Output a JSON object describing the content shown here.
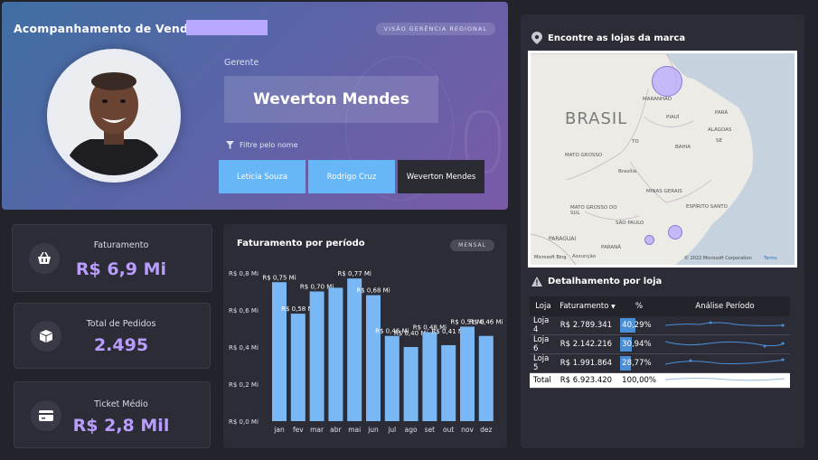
{
  "header": {
    "title": "Acompanhamento de Vendas",
    "tag": "VISÃO GERÊNCIA REGIONAL",
    "manager_label": "Gerente",
    "manager_name": "Weverton Mendes",
    "filter_label": "Filtre pelo nome",
    "filters": [
      {
        "label": "Leticia Souza",
        "active": false
      },
      {
        "label": "Rodrigo Cruz",
        "active": false
      },
      {
        "label": "Weverton Mendes",
        "active": true
      }
    ]
  },
  "kpis": {
    "faturamento": {
      "label": "Faturamento",
      "value": "R$ 6,9 Mi",
      "icon": "shopping-basket-icon"
    },
    "pedidos": {
      "label": "Total de Pedidos",
      "value": "2.495",
      "icon": "box-icon"
    },
    "ticket": {
      "label": "Ticket Médio",
      "value": "R$ 2,8 Mil",
      "icon": "wallet-icon"
    }
  },
  "chart": {
    "title": "Faturamento por período",
    "tag": "MENSAL"
  },
  "chart_data": {
    "type": "bar",
    "title": "Faturamento por período",
    "categories": [
      "jan",
      "fev",
      "mar",
      "abr",
      "mai",
      "jun",
      "jul",
      "ago",
      "set",
      "out",
      "nov",
      "dez"
    ],
    "values": [
      0.75,
      0.58,
      0.7,
      0.72,
      0.77,
      0.68,
      0.46,
      0.4,
      0.48,
      0.41,
      0.51,
      0.46
    ],
    "data_labels": [
      "R$ 0,75 Mi",
      "R$ 0,58 Mi",
      "R$ 0,70 Mi",
      "",
      "R$ 0,77 Mi",
      "R$ 0,68 Mi",
      "R$ 0,46 Mi",
      "R$ 0,40 Mi",
      "R$ 0,48 Mi",
      "R$ 0,41 Mi",
      "R$ 0,51 Mi",
      "R$ 0,46 Mi"
    ],
    "y_ticks": [
      "R$ 0,0 Mi",
      "R$ 0,2 Mi",
      "R$ 0,4 Mi",
      "R$ 0,6 Mi",
      "R$ 0,8 Mi"
    ],
    "ylim": [
      0,
      0.8
    ],
    "bar_color": "#7ab8f5",
    "grid": false
  },
  "map": {
    "title": "Encontre as lojas da marca",
    "country_label": "BRASIL",
    "places": [
      "MARANHÃO",
      "PIAUÍ",
      "PARÁ",
      "BAHIA",
      "ALAGOAS",
      "SE",
      "TO",
      "MATO GROSSO",
      "Brasília",
      "MINAS GERAIS",
      "MATO GROSSO DO SUL",
      "SÃO PAULO",
      "ESPÍRITO SANTO",
      "PARANÁ",
      "PARAGUAI",
      "Assunção"
    ],
    "attribution": "© 2022 Microsoft Corporation",
    "terms": "Terms",
    "logo": "Microsoft Bing"
  },
  "detail": {
    "title": "Detalhamento por loja",
    "columns": [
      "Loja",
      "Faturamento",
      "%",
      "Análise Período"
    ],
    "rows": [
      {
        "loja": "Loja 4",
        "fat": "R$ 2.789.341",
        "pct": "40,29%",
        "pct_value": 40.29
      },
      {
        "loja": "Loja 6",
        "fat": "R$ 2.142.216",
        "pct": "30,94%",
        "pct_value": 30.94
      },
      {
        "loja": "Loja 5",
        "fat": "R$ 1.991.864",
        "pct": "28,77%",
        "pct_value": 28.77
      }
    ],
    "total": {
      "loja": "Total",
      "fat": "R$ 6.923.420",
      "pct": "100,00%"
    }
  },
  "colors": {
    "accent_value": "#b89cff",
    "bar": "#7ab8f5",
    "filter_button": "#67b6f7",
    "pct_bar": "#4a8fd6",
    "map_bubble": "#b9a8ff"
  }
}
